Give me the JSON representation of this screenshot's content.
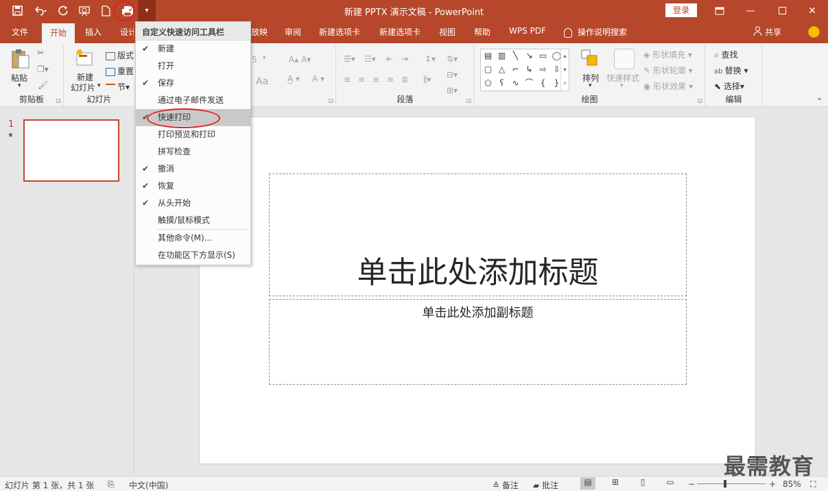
{
  "title_bar": {
    "title": "新建 PPTX 演示文稿 - PowerPoint",
    "login_label": "登录"
  },
  "qat": {
    "icons": [
      "save-icon",
      "undo-icon",
      "redo-icon",
      "start-from-beginning-icon",
      "new-icon",
      "quick-print-icon",
      "customize-dropdown-icon"
    ]
  },
  "tabs": [
    "文件",
    "开始",
    "插入",
    "设计",
    "放映",
    "审阅",
    "新建选项卡",
    "新建选项卡",
    "视图",
    "帮助",
    "WPS PDF",
    "操作说明搜索"
  ],
  "active_tab": "开始",
  "share_label": "共享",
  "ribbon": {
    "clipboard": {
      "paste": "粘贴",
      "label": "剪贴板"
    },
    "slides": {
      "new_slide_1": "新建",
      "new_slide_2": "幻灯片",
      "layout": "版式",
      "reset": "重置",
      "section": "节",
      "label": "幻灯片"
    },
    "font": {
      "size": "5",
      "aa": "Aa"
    },
    "paragraph": {
      "label": "段落"
    },
    "drawing": {
      "arrange": "排列",
      "quick_styles": "快速样式",
      "shape_fill": "形状填充",
      "shape_outline": "形状轮廓",
      "shape_effects": "形状效果",
      "label": "绘图"
    },
    "editing": {
      "find": "查找",
      "replace": "替换",
      "select": "选择",
      "label": "编辑"
    }
  },
  "dropdown": {
    "header": "自定义快速访问工具栏",
    "items": [
      {
        "label": "新建",
        "checked": true
      },
      {
        "label": "打开",
        "checked": false
      },
      {
        "label": "保存",
        "checked": true
      },
      {
        "label": "通过电子邮件发送",
        "checked": false
      },
      {
        "label": "快速打印",
        "checked": true,
        "highlighted": true
      },
      {
        "label": "打印预览和打印",
        "checked": false
      },
      {
        "label": "拼写检查",
        "checked": false
      },
      {
        "label": "撤消",
        "checked": true
      },
      {
        "label": "恢复",
        "checked": true
      },
      {
        "label": "从头开始",
        "checked": true
      },
      {
        "label": "触摸/鼠标模式",
        "checked": false
      },
      {
        "label": "其他命令(M)...",
        "checked": false
      },
      {
        "label": "在功能区下方显示(S)",
        "checked": false
      }
    ]
  },
  "slide_panel": {
    "slide_number": "1",
    "star": "★"
  },
  "slide": {
    "title_placeholder": "单击此处添加标题",
    "subtitle_placeholder": "单击此处添加副标题"
  },
  "status_bar": {
    "slide_info": "幻灯片 第 1 张，共 1 张",
    "language": "中文(中国)",
    "notes": "备注",
    "comments": "批注",
    "zoom": "85%"
  },
  "watermark": "最需教育",
  "colors": {
    "accent": "#b7472a",
    "ring": "#e02020"
  }
}
